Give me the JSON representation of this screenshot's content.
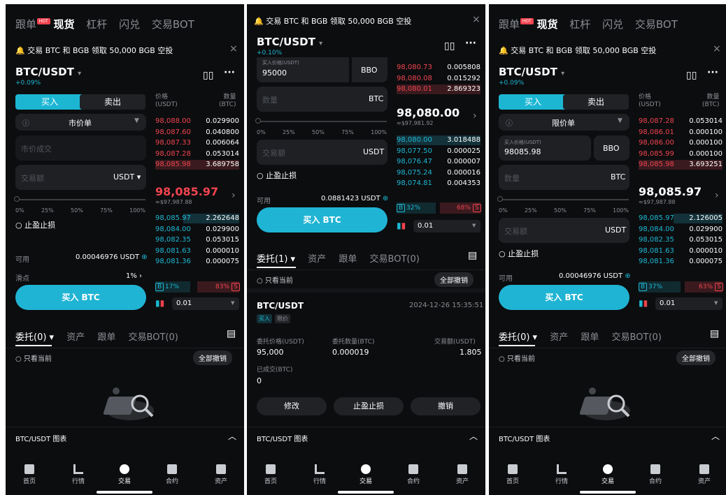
{
  "nav": {
    "copy": "跟单",
    "hot": "HOT",
    "spot": "现货",
    "margin": "杠杆",
    "swap": "闪兑",
    "bot": "交易BOT"
  },
  "notice": {
    "text": "交易 BTC 和 BGB 领取 50,000 BGB 空投",
    "close": "×"
  },
  "pair": {
    "name": "BTC/USDT",
    "arrow": "▾",
    "more": "···"
  },
  "left": {
    "change": "+0.09%",
    "buy": "买入",
    "sell": "卖出",
    "order_type": "市价单",
    "market_price": "市价成交",
    "amount": "交易额",
    "unit": "USDT ▾",
    "pct": [
      "0%",
      "25%",
      "50%",
      "75%",
      "100%"
    ],
    "tpsl": "止盈止损",
    "avail_label": "可用",
    "avail": "0.00046976 USDT",
    "slip_label": "滑点",
    "slip": "1% ›",
    "buy_btn": "买入 BTC",
    "ob_head_price": "价格\n(USDT)",
    "ob_head_qty": "数量\n(BTC)",
    "asks": [
      [
        "98,088.00",
        "0.029900"
      ],
      [
        "98,087.60",
        "0.040800"
      ],
      [
        "98,087.33",
        "0.006064"
      ],
      [
        "98,087.28",
        "0.053014"
      ],
      [
        "98,085.98",
        "3.689758"
      ]
    ],
    "mid": "98,085.97",
    "mid_usd": "≈$97,987.88",
    "bids": [
      [
        "98,085.97",
        "2.262648"
      ],
      [
        "98,084.00",
        "0.029900"
      ],
      [
        "98,082.35",
        "0.053015"
      ],
      [
        "98,081.63",
        "0.000010"
      ],
      [
        "98,081.36",
        "0.000075"
      ]
    ],
    "b_pct": "17%",
    "s_pct": "83%",
    "prec": "0.01"
  },
  "mid": {
    "change": "+0.10%",
    "price_label": "买入价格(USDT)",
    "price": "95000",
    "bbo": "BBO",
    "qty_ph": "数量",
    "btc": "BTC",
    "pct": [
      "0%",
      "25%",
      "50%",
      "75%",
      "100%"
    ],
    "amount": "交易额",
    "usdt": "USDT",
    "tpsl": "止盈止损",
    "avail_label": "可用",
    "avail": "0.0881423 USDT",
    "buy_btn": "买入 BTC",
    "asks": [
      [
        "98,080.73",
        "0.005808"
      ],
      [
        "98,080.08",
        "0.015292"
      ],
      [
        "98,080.01",
        "2.869323"
      ]
    ],
    "mid": "98,080.00",
    "mid_usd": "≈$97,981.92",
    "bids": [
      [
        "98,080.00",
        "3.018488"
      ],
      [
        "98,077.50",
        "0.000025"
      ],
      [
        "98,076.47",
        "0.000007"
      ],
      [
        "98,075.24",
        "0.000016"
      ],
      [
        "98,074.81",
        "0.004353"
      ]
    ],
    "b_pct": "32%",
    "s_pct": "68%",
    "prec": "0.01",
    "tabs": {
      "orders": "委托(1) ▾",
      "assets": "资产",
      "copy": "跟单",
      "bot": "交易BOT(0)"
    },
    "only_current": "只看当前",
    "cancel_all": "全部撤销",
    "order": {
      "pair": "BTC/USDT",
      "time": "2024-12-26 15:35:51",
      "side": "买入",
      "type": "限价",
      "l1": "委托价格(USDT)",
      "v1": "95,000",
      "l2": "委托数量(BTC)",
      "v2": "0.000019",
      "l3": "交易额(USDT)",
      "v3": "1.805",
      "l4": "已成交(BTC)",
      "v4": "0",
      "modify": "修改",
      "tpsl": "止盈止损",
      "cancel": "撤销"
    }
  },
  "right": {
    "change": "+0.09%",
    "buy": "买入",
    "sell": "卖出",
    "order_type": "限价单",
    "price_label": "买入价格(USDT)",
    "price": "98085.98",
    "bbo": "BBO",
    "qty_ph": "数量",
    "btc": "BTC",
    "pct": [
      "0%",
      "25%",
      "50%",
      "75%",
      "100%"
    ],
    "amount": "交易额",
    "usdt": "USDT",
    "tpsl": "止盈止损",
    "avail_label": "可用",
    "avail": "0.00046976 USDT",
    "buy_btn": "买入 BTC",
    "ob_head_price": "价格\n(USDT)",
    "ob_head_qty": "数量\n(BTC)",
    "asks": [
      [
        "98,087.28",
        "0.053014"
      ],
      [
        "98,086.01",
        "0.000100"
      ],
      [
        "98,086.00",
        "0.000100"
      ],
      [
        "98,085.99",
        "0.000100"
      ],
      [
        "98,085.98",
        "3.693251"
      ]
    ],
    "mid": "98,085.97",
    "mid_usd": "≈$97,987.88",
    "bids": [
      [
        "98,085.97",
        "2.126005"
      ],
      [
        "98,084.00",
        "0.029900"
      ],
      [
        "98,082.35",
        "0.053015"
      ],
      [
        "98,081.63",
        "0.000010"
      ],
      [
        "98,081.36",
        "0.000075"
      ]
    ],
    "b_pct": "37%",
    "s_pct": "63%",
    "prec": "0.01"
  },
  "tabs": {
    "orders": "委托(0) ▾",
    "assets": "资产",
    "copy": "跟单",
    "bot": "交易BOT(0)",
    "only_current": "只看当前",
    "cancel_all": "全部撤销"
  },
  "chart_bar": {
    "label": "BTC/USDT 图表",
    "chev": "︿"
  },
  "bottom": [
    {
      "label": "首页",
      "icon": "home-icon"
    },
    {
      "label": "行情",
      "icon": "market-icon"
    },
    {
      "label": "交易",
      "icon": "trade-icon"
    },
    {
      "label": "合约",
      "icon": "futures-icon"
    },
    {
      "label": "资产",
      "icon": "wallet-icon"
    }
  ],
  "colors": {
    "accent": "#1cb6d3",
    "ask": "#f0444f",
    "bid": "#1db8d4",
    "bg": "#0c0d0f"
  }
}
